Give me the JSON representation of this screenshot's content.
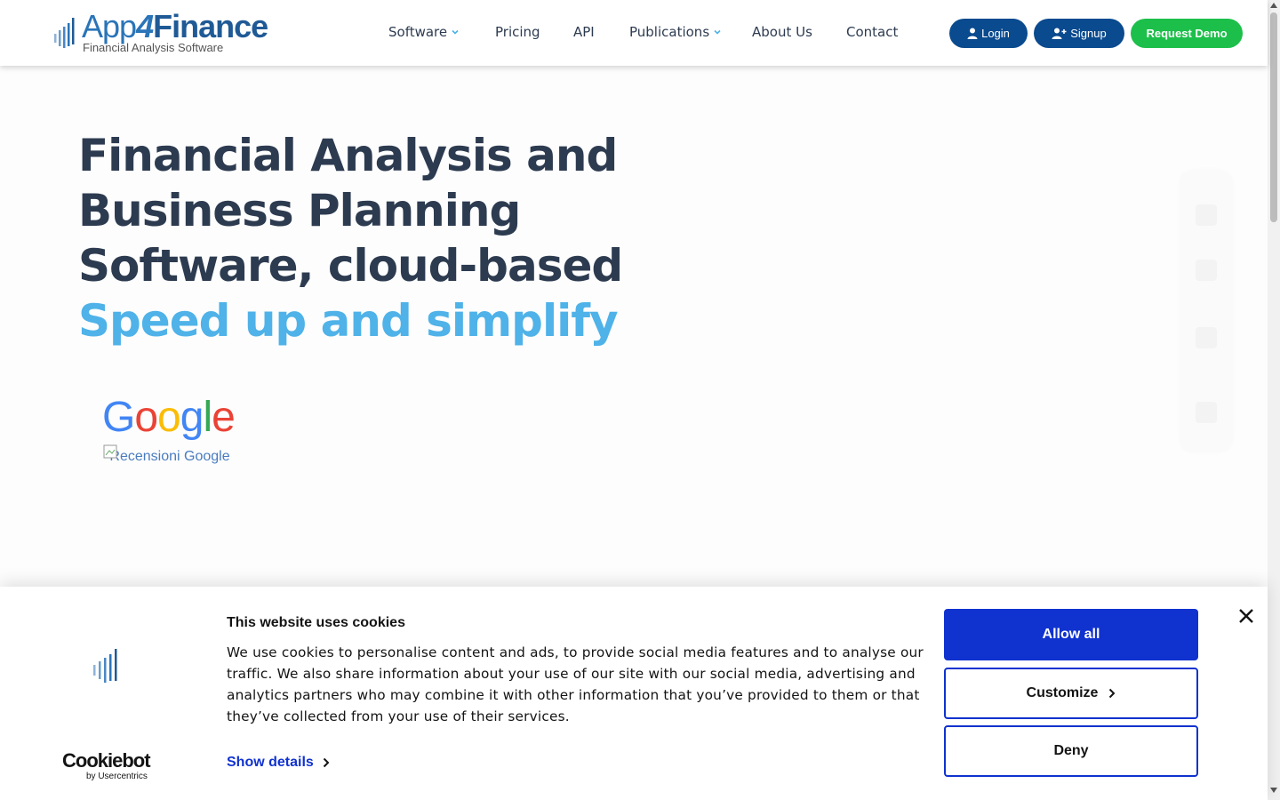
{
  "brand": {
    "name_app": "App",
    "name_four": "4",
    "name_finance": "Finance",
    "tagline": "Financial Analysis Software",
    "colors": {
      "navy": "#0a4a8e",
      "green": "#1cbf4a",
      "accent": "#4fb2e8",
      "cookie_blue": "#1032cf"
    }
  },
  "nav": {
    "items": [
      {
        "label": "Software",
        "has_dropdown": true
      },
      {
        "label": "Pricing",
        "has_dropdown": false
      },
      {
        "label": "API",
        "has_dropdown": false
      },
      {
        "label": "Publications",
        "has_dropdown": true
      },
      {
        "label": "About Us",
        "has_dropdown": false
      },
      {
        "label": "Contact",
        "has_dropdown": false
      }
    ],
    "login": "Login",
    "signup": "Signup",
    "demo": "Request Demo"
  },
  "hero": {
    "line1": "Financial Analysis and",
    "line2": "Business Planning",
    "line3": "Software, cloud-based",
    "accent": "Speed up and simplify"
  },
  "google": {
    "letters": [
      "G",
      "o",
      "o",
      "g",
      "l",
      "e"
    ],
    "alt_text": "Recensioni Google"
  },
  "cookie": {
    "title": "This website uses cookies",
    "body": "We use cookies to personalise content and ads, to provide social media features and to analyse our traffic. We also share information about your use of our site with our social media, advertising and analytics partners who may combine it with other information that you’ve provided to them or that they’ve collected from your use of their services.",
    "show_details": "Show details",
    "allow_all": "Allow all",
    "customize": "Customize",
    "deny": "Deny",
    "provider": "Cookiebot",
    "provider_sub": "by Usercentrics"
  }
}
